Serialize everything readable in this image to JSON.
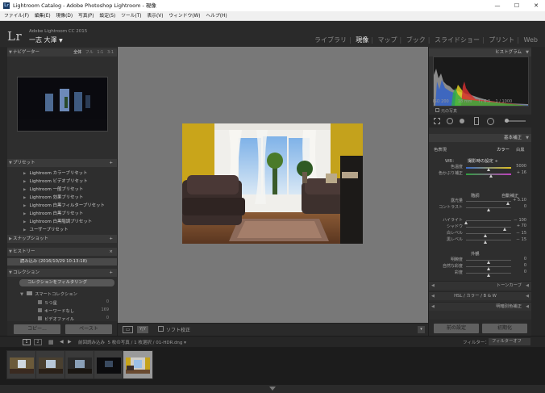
{
  "window": {
    "title": "Lightroom Catalog - Adobe Photoshop Lightroom - 現像",
    "app_icon": "Lr",
    "buttons": [
      "—",
      "☐",
      "✕"
    ]
  },
  "menu": [
    "ファイル(F)",
    "編集(E)",
    "現像(D)",
    "写真(P)",
    "設定(S)",
    "ツール(T)",
    "表示(V)",
    "ウィンドウ(W)",
    "ヘルプ(H)"
  ],
  "identity": {
    "logo": "Lr",
    "product": "Adobe Lightroom CC 2015",
    "user": "一志 大澤",
    "dropdown": "▼"
  },
  "modules": {
    "items": [
      "ライブラリ",
      "現像",
      "マップ",
      "ブック",
      "スライドショー",
      "プリント",
      "Web"
    ],
    "active": "現像",
    "sep": "|"
  },
  "left": {
    "navigator": {
      "title": "ナビゲーター",
      "tabs": [
        "全体",
        "フル",
        "1:1",
        "3:1"
      ],
      "tri": "▼"
    },
    "presets": {
      "title": "プリセット",
      "plus": "+",
      "items": [
        "Lightroom カラープリセット",
        "Lightroom ビデオプリセット",
        "Lightroom 一般プリセット",
        "Lightroom 効果プリセット",
        "Lightroom 白黒フィルタープリセット",
        "Lightroom 白黒プリセット",
        "Lightroom 白黒階調プリセット",
        "ユーザープリセット"
      ],
      "arrow": "▶"
    },
    "snapshots": {
      "title": "スナップショット",
      "plus": "+",
      "tri": "▶"
    },
    "history": {
      "title": "ヒストリー",
      "close": "×",
      "item": "読み込み (2016/10/29 10:13:18)",
      "tri": "▼"
    },
    "collections": {
      "title": "コレクション",
      "plus": "+",
      "filter": "コレクションをフィルタリング",
      "smart": "スマートコレクション",
      "items": [
        {
          "label": "５つ星",
          "count": "0"
        },
        {
          "label": "キーワードなし",
          "count": "169"
        },
        {
          "label": "ビデオファイル",
          "count": "0"
        }
      ]
    },
    "copy_label": "コピー...",
    "paste_label": "ペースト"
  },
  "toolbar": {
    "softproof": "ソフト校正",
    "view_icon": "▭",
    "yy": "Y|Y"
  },
  "right": {
    "histogram": {
      "title": "ヒストグラム",
      "info": {
        "iso": "ISO 200",
        "focal": "18 mm",
        "aperture": "f / 6.3",
        "shutter": "1 / 1000"
      },
      "orig": "元の写真",
      "tri": "▼"
    },
    "basic": {
      "title": "基本補正",
      "treatment": "色表現",
      "color": "カラー",
      "bw": "白黒",
      "wb": {
        "label": "WB：",
        "value": "撮影時の設定 ÷"
      },
      "temp": {
        "label": "色温度",
        "value": "5000",
        "pos": 0.5
      },
      "tint": {
        "label": "色かぶり補正",
        "value": "+ 16",
        "pos": 0.55
      },
      "tone": {
        "label": "階調",
        "auto": "自動補正"
      },
      "exposure": {
        "label": "露光量",
        "value": "+ 5.10",
        "pos": 0.92
      },
      "contrast": {
        "label": "コントラスト",
        "value": "0",
        "pos": 0.5
      },
      "highlights": {
        "label": "ハイライト",
        "value": "－ 100",
        "pos": 0.0
      },
      "shadows": {
        "label": "シャドウ",
        "value": "+ 70",
        "pos": 0.85
      },
      "whites": {
        "label": "白レベル",
        "value": "－ 15",
        "pos": 0.42
      },
      "blacks": {
        "label": "黒レベル",
        "value": "－ 15",
        "pos": 0.42
      },
      "presence": {
        "label": "外観"
      },
      "clarity": {
        "label": "明瞭度",
        "value": "0",
        "pos": 0.5
      },
      "vibrance": {
        "label": "自然な彩度",
        "value": "0",
        "pos": 0.5
      },
      "saturation": {
        "label": "彩度",
        "value": "0",
        "pos": 0.5
      },
      "tri": "▼"
    },
    "tonecurve": {
      "title": "トーンカーブ",
      "tri": "◀"
    },
    "hsl": {
      "tabs": "HSL  /  カラー  /  B & W",
      "tri": "◀"
    },
    "split": {
      "title": "明暗別色補正",
      "tri": "◀"
    },
    "prev_label": "前の設定",
    "reset_label": "初期化"
  },
  "filmstrip_bar": {
    "screens": [
      "1",
      "2"
    ],
    "grid": "▦",
    "arrows": [
      "◀",
      "▶"
    ],
    "source": "前回読み込み",
    "info": "5 枚の写真 / 1 枚選択 / 01-HDR.dng",
    "filter_label": "フィルター：",
    "filter_value": "フィルターオフ",
    "dd": "▾"
  },
  "colors": {
    "panel": "#2e2e2e",
    "center": "#787878",
    "header": "#3a3a3a",
    "accent": "#eeeeee"
  }
}
